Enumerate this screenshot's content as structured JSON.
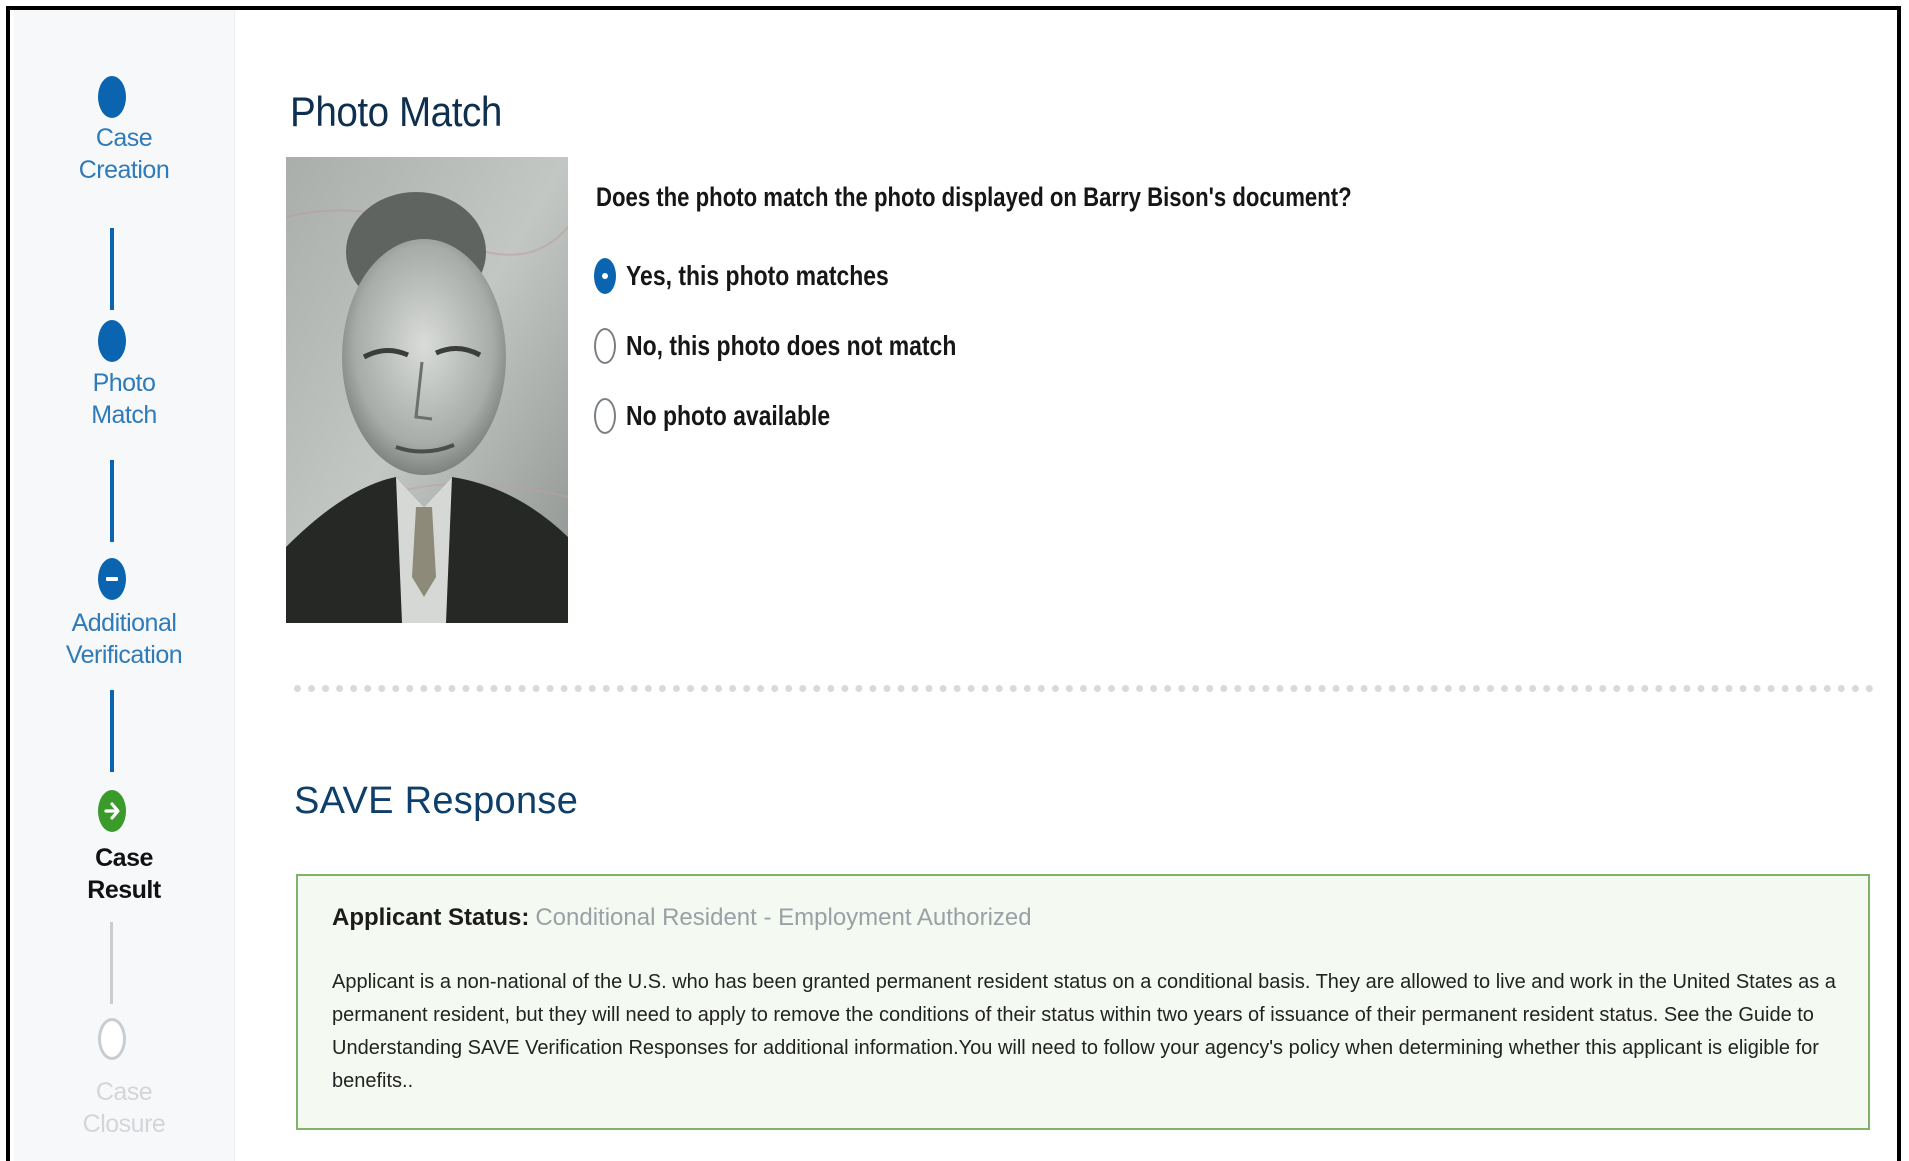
{
  "sidebar": {
    "steps": [
      {
        "line1": "Case",
        "line2": "Creation",
        "state": "done"
      },
      {
        "line1": "Photo",
        "line2": "Match",
        "state": "done"
      },
      {
        "line1": "Additional",
        "line2": "Verification",
        "state": "partial"
      },
      {
        "line1": "Case",
        "line2": "Result",
        "state": "current"
      },
      {
        "line1": "Case",
        "line2": "Closure",
        "state": "pending"
      }
    ],
    "icons": [
      "filled-circle-icon",
      "filled-circle-icon",
      "minus-circle-icon",
      "arrow-right-circle-icon",
      "empty-circle-icon"
    ]
  },
  "photo_match": {
    "title": "Photo Match",
    "question": "Does the photo match the photo displayed on Barry Bison's document?",
    "options": [
      {
        "label": "Yes, this photo matches",
        "checked": true
      },
      {
        "label": "No, this photo does not match",
        "checked": false
      },
      {
        "label": "No photo available",
        "checked": false
      }
    ]
  },
  "save_response": {
    "title": "SAVE Response",
    "status_label": "Applicant Status:",
    "status_value": "Conditional Resident - Employment Authorized",
    "description": "Applicant is a non-national of the U.S. who has been granted permanent resident status on a conditional basis. They are allowed to live and work in the United States as a permanent resident, but they will need to apply to remove the conditions of their status within two years of issuance of their permanent resident status. See the Guide to Understanding SAVE Verification Responses for additional information.You will need to follow your agency's policy when determining whether this applicant is eligible for benefits.."
  },
  "colors": {
    "primary": "#0a64b0",
    "success": "#3a9a2a",
    "box_border": "#7fb36a",
    "title": "#0e2f4f"
  }
}
